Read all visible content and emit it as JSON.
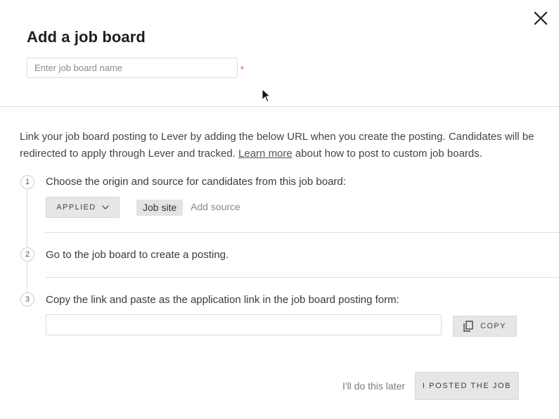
{
  "modal": {
    "title": "Add a job board",
    "close_icon": "close-icon"
  },
  "name_field": {
    "placeholder": "Enter job board name",
    "value": "",
    "required_marker": "*"
  },
  "intro": {
    "text_before_link": "Link your job board posting to Lever by adding the below URL when you create the posting. Candidates will be redirected to apply through Lever and tracked. ",
    "link_text": "Learn more",
    "text_after_link": " about how to post to custom job boards."
  },
  "steps": [
    {
      "number": "1",
      "text": "Choose the origin and source for candidates from this job board:"
    },
    {
      "number": "2",
      "text": "Go to the job board to create a posting."
    },
    {
      "number": "3",
      "text": "Copy the link and paste as the application link in the job board posting form:"
    }
  ],
  "origin": {
    "selected": "APPLIED",
    "icon": "chevron-down-icon"
  },
  "source": {
    "tag": "Job site",
    "add_placeholder": "Add source"
  },
  "link_field": {
    "value": ""
  },
  "copy_button": {
    "label": "COPY",
    "icon": "copy-icon"
  },
  "footer": {
    "later_label": "I'll do this later",
    "posted_label": "I POSTED THE JOB"
  },
  "colors": {
    "required": "#d9534f",
    "button_bg": "#e6e6e6",
    "divider": "#dedede"
  }
}
